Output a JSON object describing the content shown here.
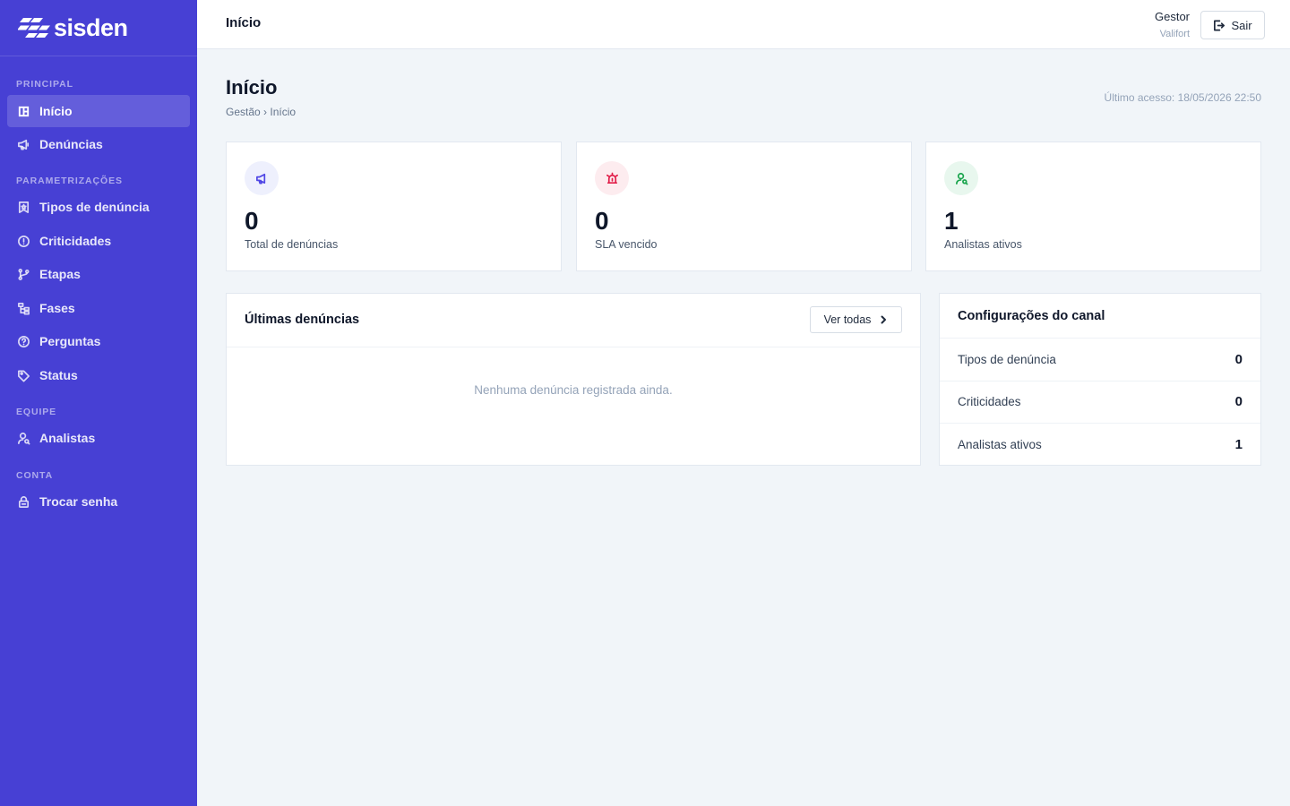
{
  "brand": {
    "name": "sisden"
  },
  "sidebar": {
    "sections": [
      {
        "label": "PRINCIPAL"
      },
      {
        "label": "PARAMETRIZAÇÕES"
      },
      {
        "label": "EQUIPE"
      },
      {
        "label": "CONTA"
      }
    ],
    "items": [
      {
        "label": "Início",
        "icon": "dashboard-icon",
        "active": true
      },
      {
        "label": "Denúncias",
        "icon": "megaphone-icon"
      },
      {
        "label": "Tipos de denúncia",
        "icon": "bookmark-icon"
      },
      {
        "label": "Criticidades",
        "icon": "alert-circle-icon"
      },
      {
        "label": "Etapas",
        "icon": "git-branch-icon"
      },
      {
        "label": "Fases",
        "icon": "hierarchy-icon"
      },
      {
        "label": "Perguntas",
        "icon": "help-circle-icon"
      },
      {
        "label": "Status",
        "icon": "tag-icon"
      },
      {
        "label": "Analistas",
        "icon": "user-search-icon"
      },
      {
        "label": "Trocar senha",
        "icon": "lock-icon"
      }
    ]
  },
  "topbar": {
    "title": "Início",
    "user_name": "Gestor",
    "user_org": "Valifort",
    "logout_label": "Sair"
  },
  "header": {
    "title": "Início",
    "breadcrumb": "Gestão › Início",
    "last_access": "Último acesso: 18/05/2026 22:50"
  },
  "stats": [
    {
      "value": "0",
      "label": "Total de denúncias",
      "icon": "megaphone-icon",
      "color": "#4f46e5",
      "bg": "#eef0fd"
    },
    {
      "value": "0",
      "label": "SLA vencido",
      "icon": "siren-icon",
      "color": "#e11d48",
      "bg": "#fdecef"
    },
    {
      "value": "1",
      "label": "Analistas ativos",
      "icon": "user-search-icon",
      "color": "#16a34a",
      "bg": "#e8f7ee"
    }
  ],
  "latest": {
    "title": "Últimas denúncias",
    "see_all_label": "Ver todas",
    "empty_text": "Nenhuma denúncia registrada ainda."
  },
  "config": {
    "title": "Configurações do canal",
    "rows": [
      {
        "label": "Tipos de denúncia",
        "value": "0"
      },
      {
        "label": "Criticidades",
        "value": "0"
      },
      {
        "label": "Analistas ativos",
        "value": "1"
      }
    ]
  },
  "colors": {
    "sidebar": "#4740d4",
    "background": "#f1f5f9"
  }
}
